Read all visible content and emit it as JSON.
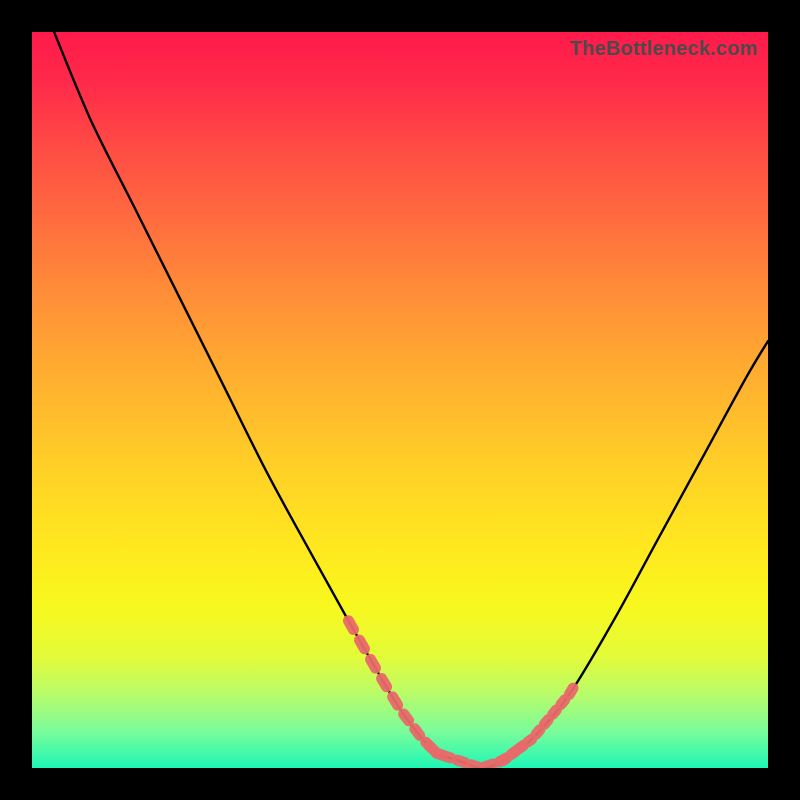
{
  "attribution": "TheBottleneck.com",
  "colors": {
    "curve": "#000000",
    "highlight": "#e96a6a",
    "gradient_stops": [
      "#ff1a4b",
      "#ff2a4a",
      "#ff4945",
      "#ff6a3f",
      "#ff8c38",
      "#ffb22f",
      "#ffd226",
      "#ffe81f",
      "#f8f81e",
      "#e2fb3a",
      "#b8fc6a",
      "#7afc9a",
      "#1ef7b6"
    ]
  },
  "chart_data": {
    "type": "line",
    "title": "",
    "xlabel": "",
    "ylabel": "",
    "xlim": [
      0,
      100
    ],
    "ylim": [
      0,
      100
    ],
    "series": [
      {
        "name": "bottleneck-curve",
        "x": [
          3,
          8,
          14,
          20,
          26,
          32,
          38,
          43,
          47,
          50,
          53,
          55,
          58,
          61,
          64,
          68,
          73,
          79,
          85,
          91,
          97,
          100
        ],
        "y": [
          100,
          88,
          76,
          64,
          52,
          40,
          29,
          20,
          13,
          8,
          4,
          2,
          1,
          0,
          1,
          4,
          10,
          20,
          31,
          42,
          53,
          58
        ]
      }
    ],
    "highlights": [
      {
        "name": "left-dotted-lower-segment",
        "x_range": [
          43,
          55
        ],
        "y_range": [
          2,
          20
        ]
      },
      {
        "name": "right-dotted-lower-segment",
        "x_range": [
          64,
          73
        ],
        "y_range": [
          1,
          10
        ]
      }
    ]
  }
}
